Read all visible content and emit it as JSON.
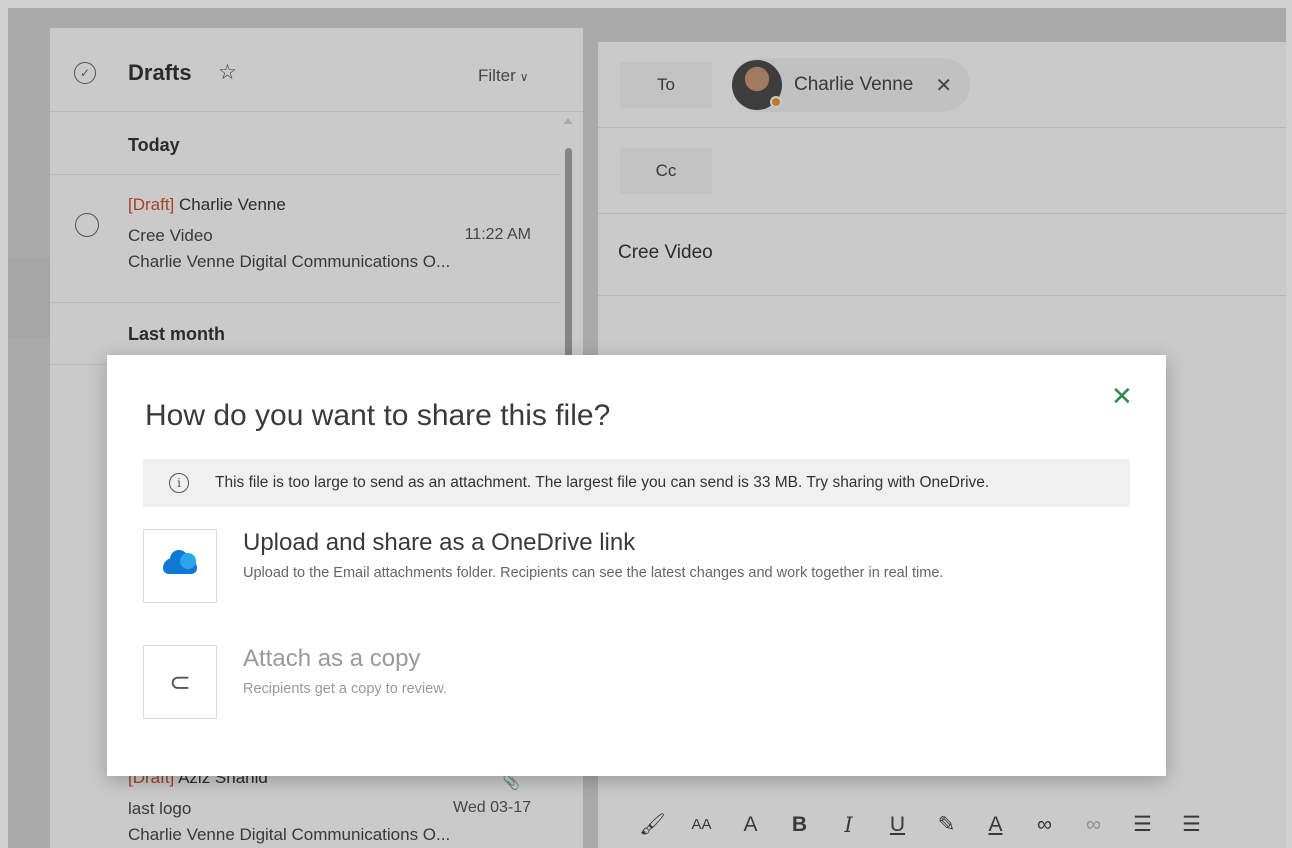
{
  "mail_list": {
    "folder_title": "Drafts",
    "filter_label": "Filter",
    "sections": [
      "Today",
      "Last month"
    ],
    "messages": [
      {
        "draft_tag": "[Draft]",
        "sender": "Charlie Venne",
        "subject": "Cree Video",
        "time": "11:22 AM",
        "preview": "Charlie Venne Digital Communications O..."
      },
      {
        "draft_tag": "[Draft]",
        "sender": "Aziz Shahid",
        "subject": "last logo",
        "time": "Wed 03-17",
        "preview": "Charlie Venne Digital Communications O..."
      }
    ]
  },
  "compose": {
    "to_label": "To",
    "cc_label": "Cc",
    "recipient_name": "Charlie Venne",
    "subject": "Cree Video"
  },
  "dialog": {
    "title": "How do you want to share this file?",
    "info_text": "This file is too large to send as an attachment. The largest file you can send is 33 MB. Try sharing with OneDrive.",
    "options": [
      {
        "title": "Upload and share as a OneDrive link",
        "description": "Upload to the Email attachments folder. Recipients can see the latest changes and work together in real time."
      },
      {
        "title": "Attach as a copy",
        "description": "Recipients get a copy to review."
      }
    ]
  },
  "toolbar": {
    "bold": "B",
    "italic": "I",
    "underline": "U",
    "font_size": "AA",
    "font_grow": "A",
    "font_color": "A"
  },
  "colors": {
    "accent_green": "#2a8a4a",
    "draft_red": "#c4411a",
    "onedrive_blue": "#0f78d4"
  }
}
